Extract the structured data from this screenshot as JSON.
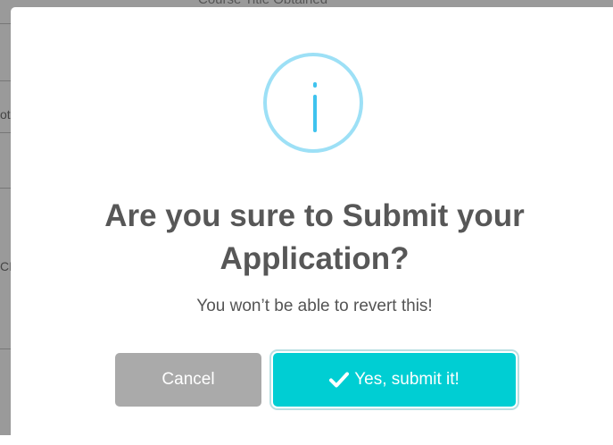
{
  "background": {
    "header_text": "Course Title Obtained",
    "left_fragments": [
      "ot",
      "CI"
    ]
  },
  "dialog": {
    "icon": "info-icon",
    "icon_glyph": "i",
    "title": "Are you sure to Submit your Application?",
    "message": "You won’t be able to revert this!",
    "cancel_label": "Cancel",
    "confirm_label": "Yes, submit it!",
    "confirm_icon": "check-icon"
  },
  "colors": {
    "confirm_button": "#00ced3",
    "cancel_button": "#aaaaaa",
    "info_ring": "#9de0f6",
    "info_glyph": "#3fc3ee",
    "title_text": "#575757"
  }
}
